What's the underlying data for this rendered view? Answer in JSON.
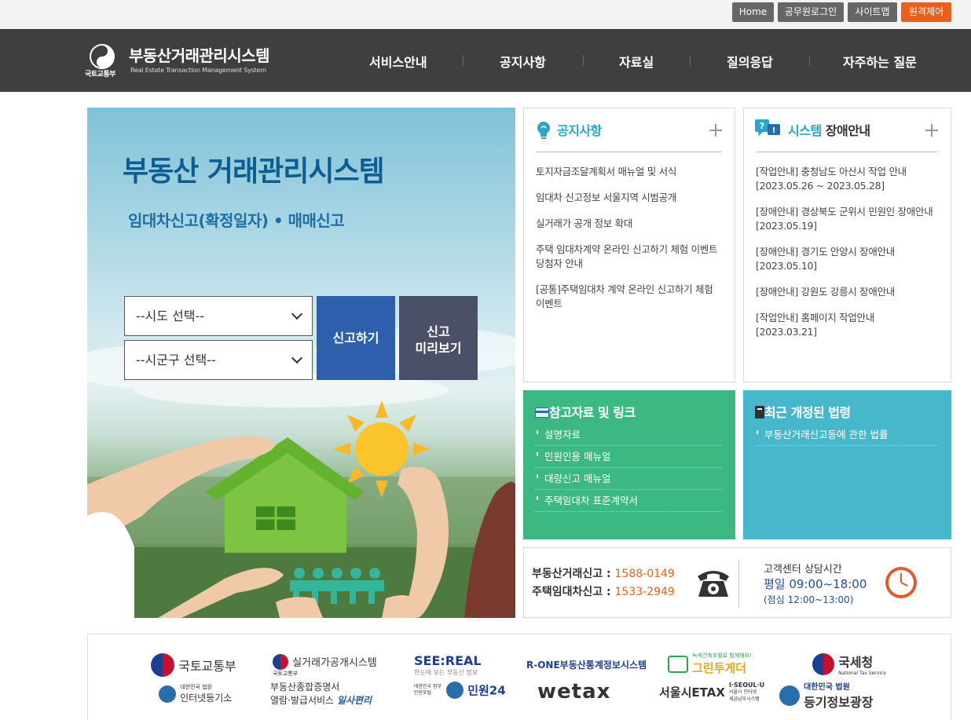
{
  "util": {
    "home": "Home",
    "login": "공무원로그인",
    "sitemap": "사이트맵",
    "remote": "원격제어"
  },
  "header": {
    "ministry": "국토교통부",
    "title": "부동산거래관리시스템",
    "subtitle": "Real Estate Transaction Management System",
    "nav": [
      "서비스안내",
      "공지사항",
      "자료실",
      "질의응답",
      "자주하는 질문"
    ]
  },
  "hero": {
    "title": "부동산 거래관리시스템",
    "subtitle": "임대차신고(확정일자) • 매매신고",
    "sido_select": "--시도 선택--",
    "sigungu_select": "--시군구 선택--",
    "report_button": "신고하기",
    "preview_button_line1": "신고",
    "preview_button_line2": "미리보기"
  },
  "notice": {
    "title": "공지사항",
    "items": [
      "토지자금조달계획서 매뉴얼 및 서식",
      "임대차 신고정보 서울지역 시범공개",
      "실거래가 공개 정보 확대",
      "주택 임대차계약 온라인 신고하기 체험 이벤트 당첨자 안내",
      "[공통]주택임대차 계약 온라인 신고하기 체험 이벤트"
    ]
  },
  "outage": {
    "title_accent": "시스템",
    "title_rest": "장애안내",
    "items": [
      "[작업안내] 충청남도 아산시 작업 안내 [2023.05.26 ~ 2023.05.28]",
      "[장애안내] 경상북도 군위시 민원인 장애안내 [2023.05.19]",
      "[장애안내] 경기도 안양시 장애안내 [2023.05.10]",
      "[장애안내] 강원도 강릉시 장애안내",
      "[작업안내] 홈페이지 작업안내 [2023.03.21]"
    ]
  },
  "references": {
    "title": "참고자료 및 링크",
    "items": [
      "설명자료",
      "민원인용 매뉴얼",
      "대량신고 매뉴얼",
      "주택임대차 표준계약서"
    ]
  },
  "laws": {
    "title": "최근 개정된 법령",
    "items": [
      "부동산거래신고등에 관한 법률"
    ]
  },
  "contact": {
    "line1_label": "부동산거래신고 : ",
    "line1_number": "1588-0149",
    "line2_label": "주택임대차신고 : ",
    "line2_number": "1533-2949",
    "hours_title": "고객센터 상담시간",
    "hours": "평일 09:00~18:00",
    "lunch": "(점심 12:00~13:00)"
  },
  "footer": {
    "logos": [
      {
        "label": "국토교통부"
      },
      {
        "label": "실거래가공개시스템",
        "small": "국토교통부"
      },
      {
        "label": "SEE:REAL",
        "small": "한눈에 보는 부동산 정보"
      },
      {
        "label": "R-ONE부동산통계정보시스템"
      },
      {
        "label": "그린투게더",
        "small": "녹색건축포털로 함께해요!"
      },
      {
        "label": "국세청",
        "small": "National Tax Service"
      },
      {
        "label": "인터넷등기소",
        "small": "대한민국 법원"
      },
      {
        "label_line1": "부동산종합증명서",
        "label_line2": "열람·발급서비스",
        "brand": "일사편리"
      },
      {
        "label": "민원24",
        "small": "대한민국 정부민원포털"
      },
      {
        "label": "wetax"
      },
      {
        "label": "서울시ETAX",
        "small_line1": "I·SEOUL·U",
        "small_line2": "서울시 인터넷",
        "small_line3": "세금납부시스템"
      },
      {
        "label": "등기정보광장",
        "small": "대한민국 법원"
      }
    ]
  },
  "colors": {
    "header_bg": "#403f3e",
    "remote_button": "#e8601c",
    "report_button": "#2e5fad",
    "preview_button": "#4b5068",
    "references_tile": "#3cb983",
    "laws_tile": "#47b8cb",
    "panel_accent": "#2aa6c9",
    "phone_number": "#e8601c",
    "hours": "#1f4fa0"
  },
  "icons": [
    "gov-emblem-icon",
    "lightbulb-icon",
    "question-icon",
    "card-icon",
    "book-icon",
    "telephone-icon",
    "clock-icon"
  ]
}
